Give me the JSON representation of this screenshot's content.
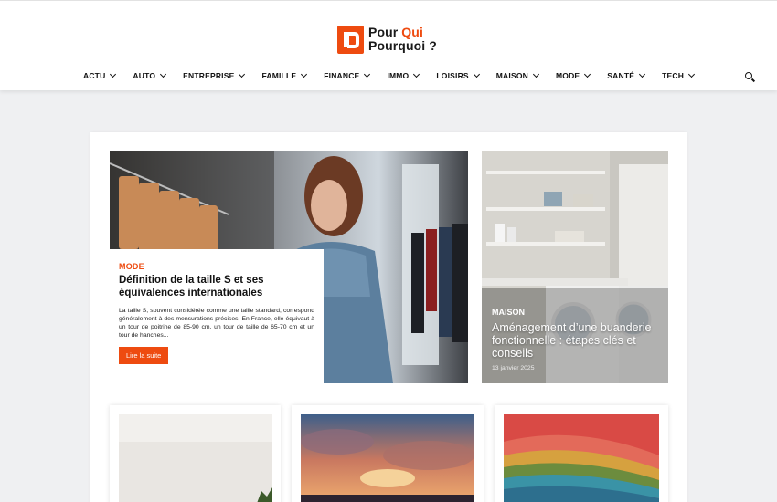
{
  "header": {
    "logo": {
      "line1": "Pour",
      "line1_accent": "Qui",
      "line2": "Pourquoi ?"
    },
    "nav": [
      {
        "label": "ACTU"
      },
      {
        "label": "AUTO"
      },
      {
        "label": "ENTREPRISE"
      },
      {
        "label": "FAMILLE"
      },
      {
        "label": "FINANCE"
      },
      {
        "label": "IMMO"
      },
      {
        "label": "LOISIRS"
      },
      {
        "label": "MAISON"
      },
      {
        "label": "MODE"
      },
      {
        "label": "SANTÉ"
      },
      {
        "label": "TECH"
      }
    ],
    "search_icon": "search-icon"
  },
  "featured": {
    "category": "MODE",
    "title": "Définition de la taille S et ses équivalences internationales",
    "excerpt": "La taille S, souvent considérée comme une taille standard, correspond généralement à des mensurations précises. En France, elle équivaut à un tour de poitrine de 85-90 cm, un tour de taille de 65-70 cm et un tour de hanches...",
    "read_more": "Lire la suite"
  },
  "side": {
    "category": "MAISON",
    "title": "Aménagement d’une buanderie fonctionnelle : étapes clés et conseils",
    "date": "13 janvier 2025"
  },
  "colors": {
    "accent": "#ee4b10",
    "background": "#eff0f2"
  }
}
